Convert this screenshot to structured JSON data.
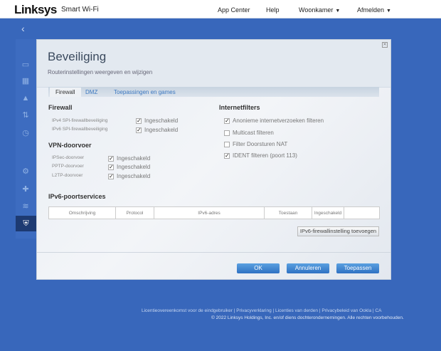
{
  "header": {
    "logo": "Linksys",
    "product": "Smart Wi-Fi",
    "nav": [
      "App Center",
      "Help",
      "Woonkamer",
      "Afmelden"
    ]
  },
  "modal": {
    "title": "Beveiliging",
    "subtitle": "Routerinstellingen weergeven en wijzigen",
    "tabs": [
      "Firewall",
      "DMZ",
      "Toepassingen en games"
    ],
    "firewall": {
      "heading": "Firewall",
      "rows": [
        {
          "label": "IPv4 SPI-firewallbeveiliging",
          "value": "Ingeschakeld",
          "checked": true
        },
        {
          "label": "IPv6 SPI-firewallbeveiliging",
          "value": "Ingeschakeld",
          "checked": true
        }
      ]
    },
    "vpn": {
      "heading": "VPN-doorvoer",
      "rows": [
        {
          "label": "IPSec-doorvoer",
          "value": "Ingeschakeld",
          "checked": true
        },
        {
          "label": "PPTP-doorvoer",
          "value": "Ingeschakeld",
          "checked": true
        },
        {
          "label": "L2TP-doorvoer",
          "value": "Ingeschakeld",
          "checked": true
        }
      ]
    },
    "filters": {
      "heading": "Internetfilters",
      "items": [
        {
          "label": "Anonieme internetverzoeken filteren",
          "checked": true
        },
        {
          "label": "Multicast filteren",
          "checked": false
        },
        {
          "label": "Filter Doorsturen NAT",
          "checked": false
        },
        {
          "label": "IDENT filteren (poort 113)",
          "checked": true
        }
      ]
    },
    "ipv6": {
      "heading": "IPv6-poortservices",
      "columns": [
        "Omschrijving",
        "Protocol",
        "IPv6-adres",
        "Toestaan",
        "Ingeschakeld",
        ""
      ],
      "add_button": "IPv6-firewallinstelling toevoegen"
    },
    "buttons": {
      "ok": "OK",
      "cancel": "Annuleren",
      "apply": "Toepassen"
    }
  },
  "footer": {
    "links": [
      "Licentieovereenkomst voor de eindgebruiker",
      "Privacyverklaring",
      "Licenties van derden",
      "Privacybeleid van Ookla",
      "CA"
    ],
    "copyright": "© 2022 Linksys Holdings, Inc. en/of diens dochterondernemingen. Alle rechten voorbehouden."
  }
}
